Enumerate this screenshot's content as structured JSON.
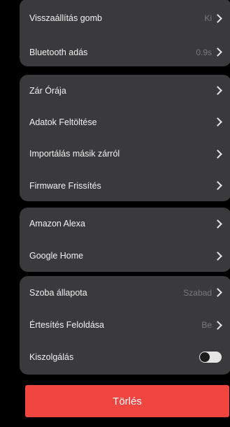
{
  "section1": {
    "items": [
      {
        "label": "Visszaállítás gomb",
        "value": "Ki"
      },
      {
        "label": "Bluetooth adás",
        "value": "0.9s"
      }
    ]
  },
  "section2": {
    "items": [
      {
        "label": "Zár Órája"
      },
      {
        "label": "Adatok Feltöltése"
      },
      {
        "label": "Importálás másik zárról"
      },
      {
        "label": "Firmware Frissítés"
      }
    ]
  },
  "section3": {
    "items": [
      {
        "label": "Amazon Alexa"
      },
      {
        "label": "Google Home"
      }
    ]
  },
  "section4": {
    "items": [
      {
        "label": "Szoba állapota",
        "value": "Szabad"
      },
      {
        "label": "Értesítés Feloldása",
        "value": "Be"
      },
      {
        "label": "Kiszolgálás",
        "toggle_on": false
      }
    ]
  },
  "delete_button": {
    "label": "Törlés",
    "color": "#f0463f"
  },
  "colors": {
    "background": "#000000",
    "card": "#3a3a3c",
    "value_text": "#7a7a7c"
  }
}
